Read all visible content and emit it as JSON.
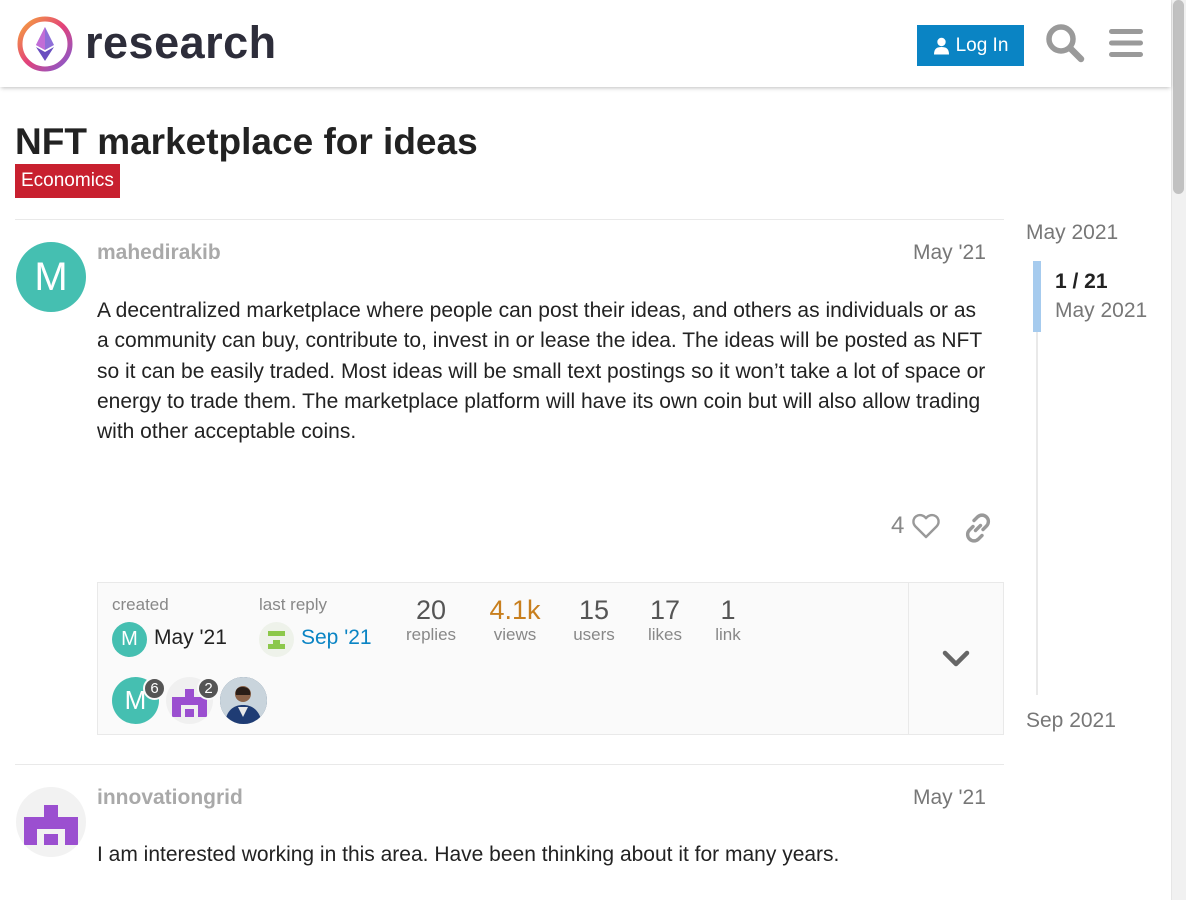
{
  "header": {
    "logo_text": "research",
    "login_label": "Log In"
  },
  "topic": {
    "title": "NFT marketplace for ideas",
    "category": "Economics"
  },
  "posts": [
    {
      "username": "mahedirakib",
      "avatar_letter": "M",
      "date": "May '21",
      "body": "A decentralized marketplace where people can post their ideas, and others as individuals or as a community can buy, contribute to, invest in or lease the idea. The ideas will be posted as NFT so it can be easily traded. Most ideas will be small text postings so it won’t take a lot of space or energy to trade them. The marketplace platform will have its own coin but will also allow trading with other acceptable coins.",
      "likes": "4"
    },
    {
      "username": "innovationgrid",
      "date": "May '21",
      "body": "I am interested working in this area. Have been thinking about it for many years."
    }
  ],
  "topic_map": {
    "created_label": "created",
    "created_avatar_letter": "M",
    "created_date": "May '21",
    "last_reply_label": "last reply",
    "last_reply_date": "Sep '21",
    "stats": [
      {
        "value": "20",
        "label": "replies"
      },
      {
        "value": "4.1k",
        "label": "views"
      },
      {
        "value": "15",
        "label": "users"
      },
      {
        "value": "17",
        "label": "likes"
      },
      {
        "value": "1",
        "label": "link"
      }
    ],
    "participants": [
      {
        "letter": "M",
        "count": "6"
      },
      {
        "letter": "",
        "count": "2"
      },
      {
        "letter": "",
        "count": ""
      }
    ]
  },
  "timeline": {
    "start": "May 2021",
    "position": "1 / 21",
    "position_date": "May 2021",
    "end": "Sep 2021"
  },
  "colors": {
    "brand_blue": "#0a84c4",
    "category_red": "#c8202f",
    "avatar_teal": "#45bfb1",
    "avatar_purple": "#9b4fd0",
    "hot_views": "#c87f1e"
  }
}
